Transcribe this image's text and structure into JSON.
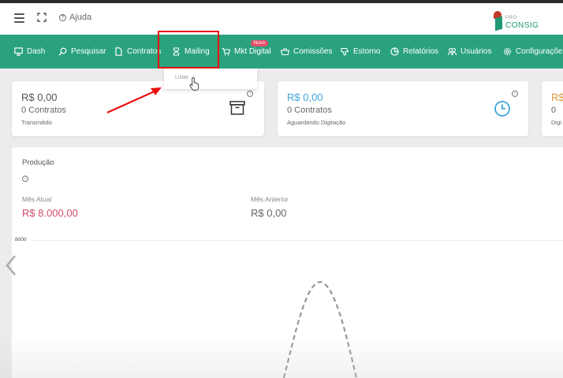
{
  "topbar": {
    "help_label": "Ajuda",
    "logo_small": "PRO",
    "logo_text": "CONSIG"
  },
  "nav": {
    "items": [
      {
        "label": "Dash",
        "icon": "monitor-icon"
      },
      {
        "label": "Pesquisar",
        "icon": "search-icon"
      },
      {
        "label": "Contratos",
        "icon": "document-icon"
      },
      {
        "label": "Mailing",
        "icon": "mailing-icon"
      },
      {
        "label": "Mkt Digital",
        "icon": "cart-icon"
      },
      {
        "label": "Comissões",
        "icon": "basket-icon"
      },
      {
        "label": "Estorno",
        "icon": "thumbs-down-icon"
      },
      {
        "label": "Relatórios",
        "icon": "pie-chart-icon"
      },
      {
        "label": "Usuários",
        "icon": "users-icon"
      },
      {
        "label": "Configurações",
        "icon": "gear-icon"
      }
    ],
    "badge": "Novo"
  },
  "dropdown": {
    "item": "Listar"
  },
  "cards": [
    {
      "amount": "R$ 0,00",
      "count": "0 Contratos",
      "sub": "Transmitido",
      "amount_color": "#555555",
      "icon": "archive-icon"
    },
    {
      "amount": "R$ 0,00",
      "count": "0 Contratos",
      "sub": "Aguardando Digitação",
      "amount_color": "#3ea6d8",
      "icon": "clock-icon"
    },
    {
      "amount": "R$",
      "count": "0",
      "sub": "Digi",
      "amount_color": "#e0953a"
    }
  ],
  "production": {
    "title": "Produção",
    "current_label": "Mês Atual",
    "current_value": "R$ 8.000,00",
    "current_color": "#d14a6b",
    "previous_label": "Mês Anterior",
    "previous_value": "R$ 0,00",
    "ytick": "8000"
  },
  "colors": {
    "nav_bg": "#2aa27d",
    "highlight": "#e81010"
  }
}
